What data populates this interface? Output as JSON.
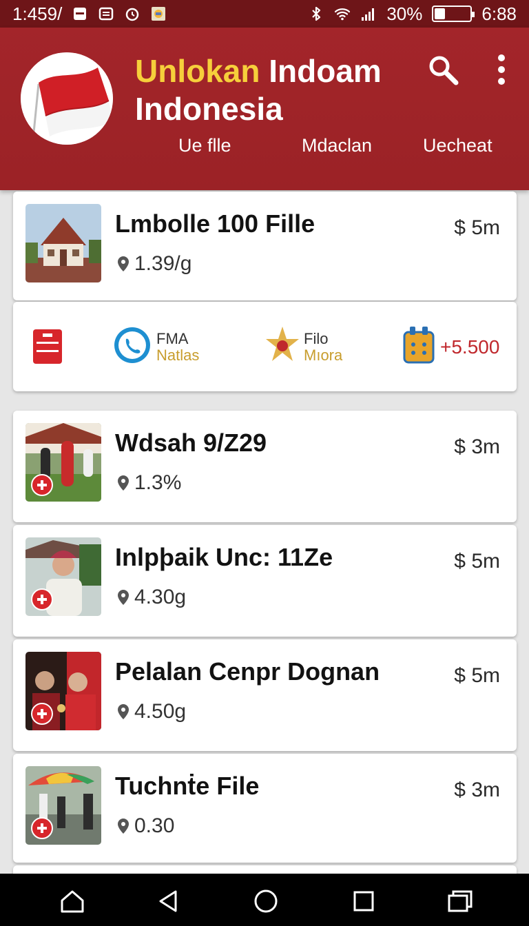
{
  "status_bar": {
    "time_left": "1:459/",
    "battery": "30%",
    "battery_level": 0.3,
    "time_right": "6:88"
  },
  "header": {
    "title_part1": "Unlokan",
    "title_part2": "Indoam",
    "title_line2": "Indonesia",
    "tabs": [
      "Ue flle",
      "Mdaclan",
      "Uecheat"
    ],
    "colors": {
      "bar": "#9b2226",
      "accent": "#f6cf3b"
    }
  },
  "list": {
    "items": [
      {
        "title": "Lmbolle 100 Fille",
        "meta": "1.39/g",
        "price": "$ 5m"
      },
      {
        "title": "Wdsah 9/Z29",
        "meta": "1.3%",
        "price": "$ 3m"
      },
      {
        "title": "Inlpþaik Unc: 11Ze",
        "meta": "4.30g",
        "price": "$ 5m"
      },
      {
        "title": "Pelalan Cenpr Dognan",
        "meta": "4.50g",
        "price": "$ 5m"
      },
      {
        "title": "Tuchnṫe File",
        "meta": "0.30",
        "price": "$ 3m"
      }
    ]
  },
  "shortcuts": {
    "item1": {
      "l1": "FMA",
      "l2": "Natlas"
    },
    "item2": {
      "l1": "Filo",
      "l2": "Mıora"
    },
    "item3_value": "+5.500"
  },
  "icons": [
    "wifi-icon",
    "signal-icon",
    "bluetooth-icon",
    "search-icon",
    "more-vert-icon",
    "map-pin-icon",
    "home-icon",
    "back-icon",
    "overview-icon"
  ]
}
